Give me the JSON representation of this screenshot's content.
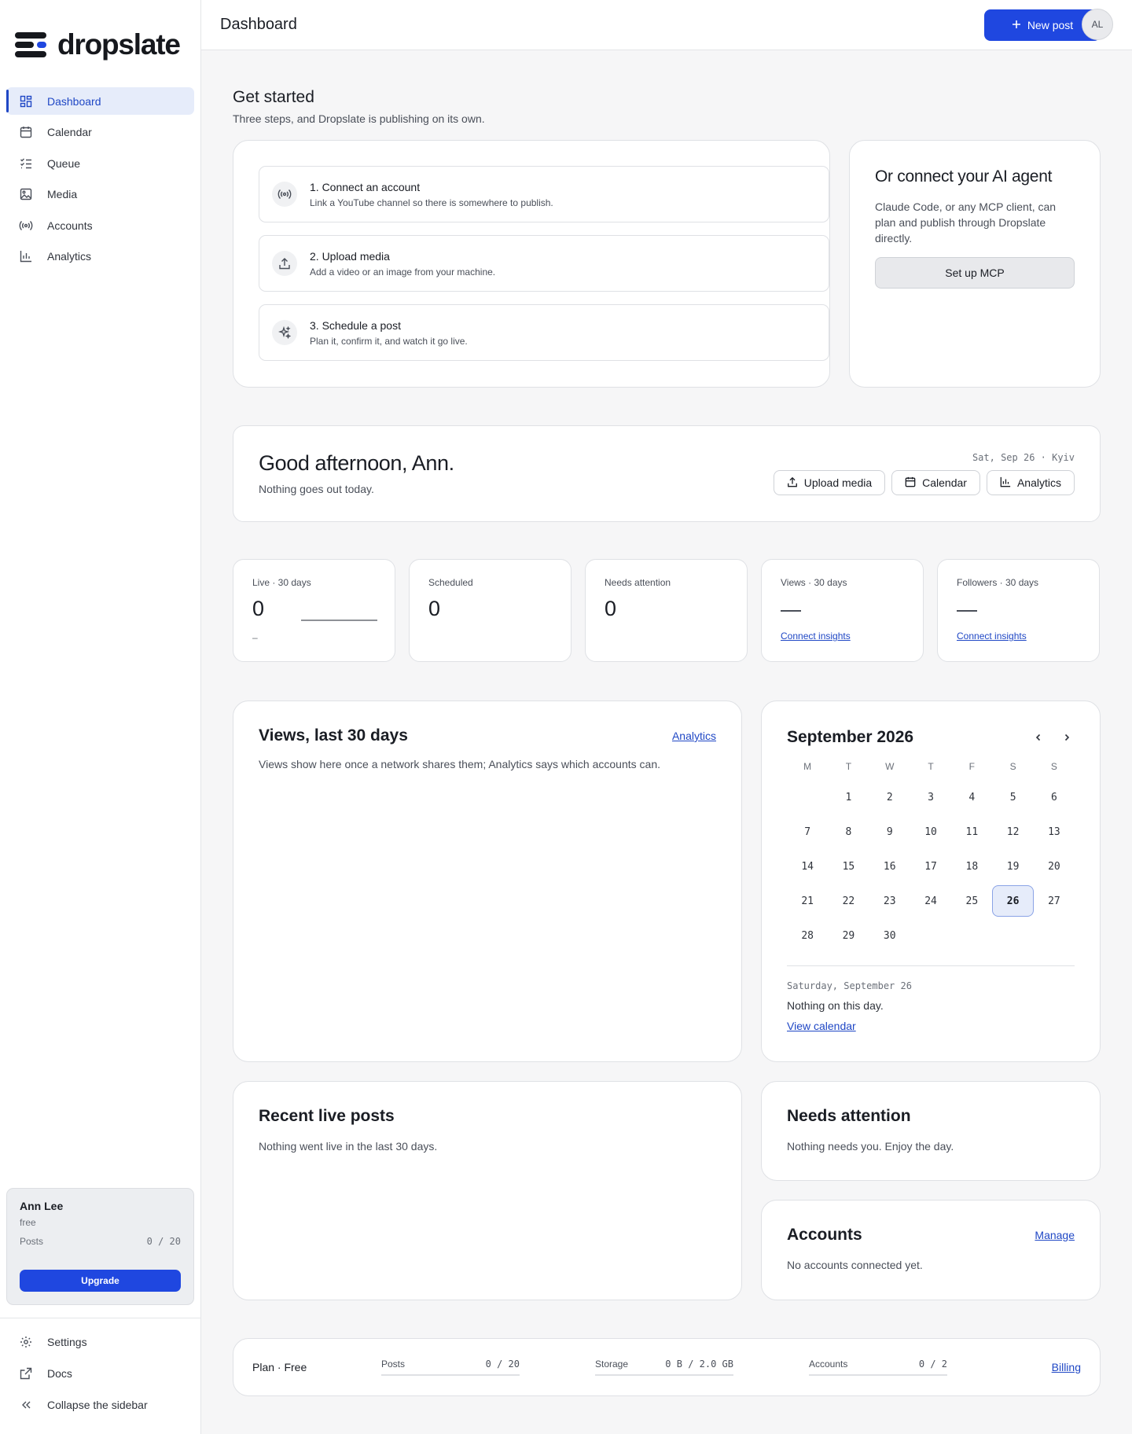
{
  "brand": {
    "name": "dropslate"
  },
  "sidebar": {
    "items": [
      {
        "label": "Dashboard",
        "icon": "dashboard-grid-icon"
      },
      {
        "label": "Calendar",
        "icon": "calendar-icon"
      },
      {
        "label": "Queue",
        "icon": "list-checks-icon"
      },
      {
        "label": "Media",
        "icon": "image-icon"
      },
      {
        "label": "Accounts",
        "icon": "broadcast-icon"
      },
      {
        "label": "Analytics",
        "icon": "bar-chart-icon"
      }
    ],
    "user": {
      "name": "Ann Lee",
      "plan": "free",
      "posts_label": "Posts",
      "posts_value": "0 / 20",
      "upgrade_label": "Upgrade"
    },
    "bottom": [
      {
        "label": "Settings",
        "icon": "gear-icon"
      },
      {
        "label": "Docs",
        "icon": "external-link-icon"
      },
      {
        "label": "Collapse the sidebar",
        "icon": "chevrons-left-icon"
      }
    ]
  },
  "header": {
    "title": "Dashboard",
    "new_post_label": "New post",
    "avatar_initials": "AL"
  },
  "get_started": {
    "title": "Get started",
    "subtitle": "Three steps, and Dropslate is publishing on its own.",
    "steps": [
      {
        "title": "1. Connect an account",
        "subtitle": "Link a YouTube channel so there is somewhere to publish."
      },
      {
        "title": "2. Upload media",
        "subtitle": "Add a video or an image from your machine."
      },
      {
        "title": "3. Schedule a post",
        "subtitle": "Plan it, confirm it, and watch it go live."
      }
    ]
  },
  "mcp": {
    "title": "Or connect your AI agent",
    "text": "Claude Code, or any MCP client, can plan and publish through Dropslate directly.",
    "button_label": "Set up MCP"
  },
  "greeting": {
    "title": "Good afternoon, Ann.",
    "subtitle": "Nothing goes out today.",
    "date": "Sat, Sep 26 · Kyiv",
    "actions": [
      "Upload media",
      "Calendar",
      "Analytics"
    ]
  },
  "stats": [
    {
      "label": "Live · 30 days",
      "value": "0",
      "sub": "–"
    },
    {
      "label": "Scheduled",
      "value": "0"
    },
    {
      "label": "Needs attention",
      "value": "0"
    },
    {
      "label": "Views · 30 days",
      "link": "Connect insights"
    },
    {
      "label": "Followers · 30 days",
      "link": "Connect insights"
    }
  ],
  "views": {
    "title": "Views, last 30 days",
    "link": "Analytics",
    "text": "Views show here once a network shares them; Analytics says which accounts can."
  },
  "calendar": {
    "month": "September 2026",
    "weekdays": [
      "M",
      "T",
      "W",
      "T",
      "F",
      "S",
      "S"
    ],
    "leading_blanks": 1,
    "days": 30,
    "today": 26,
    "selected_label": "Saturday, September 26",
    "selected_text": "Nothing on this day.",
    "view_link": "View calendar"
  },
  "recent": {
    "title": "Recent live posts",
    "text": "Nothing went live in the last 30 days."
  },
  "attention": {
    "title": "Needs attention",
    "text": "Nothing needs you. Enjoy the day."
  },
  "accounts": {
    "title": "Accounts",
    "link": "Manage",
    "text": "No accounts connected yet."
  },
  "footer": {
    "plan": "Plan · Free",
    "posts_label": "Posts",
    "posts_value": "0 / 20",
    "storage_label": "Storage",
    "storage_value": "0 B / 2.0 GB",
    "accounts_label": "Accounts",
    "accounts_value": "0 / 2",
    "billing_link": "Billing"
  },
  "colors": {
    "accent": "#1f47e0",
    "accent_soft": "#e6ecfa",
    "border": "#dfe1e5"
  }
}
